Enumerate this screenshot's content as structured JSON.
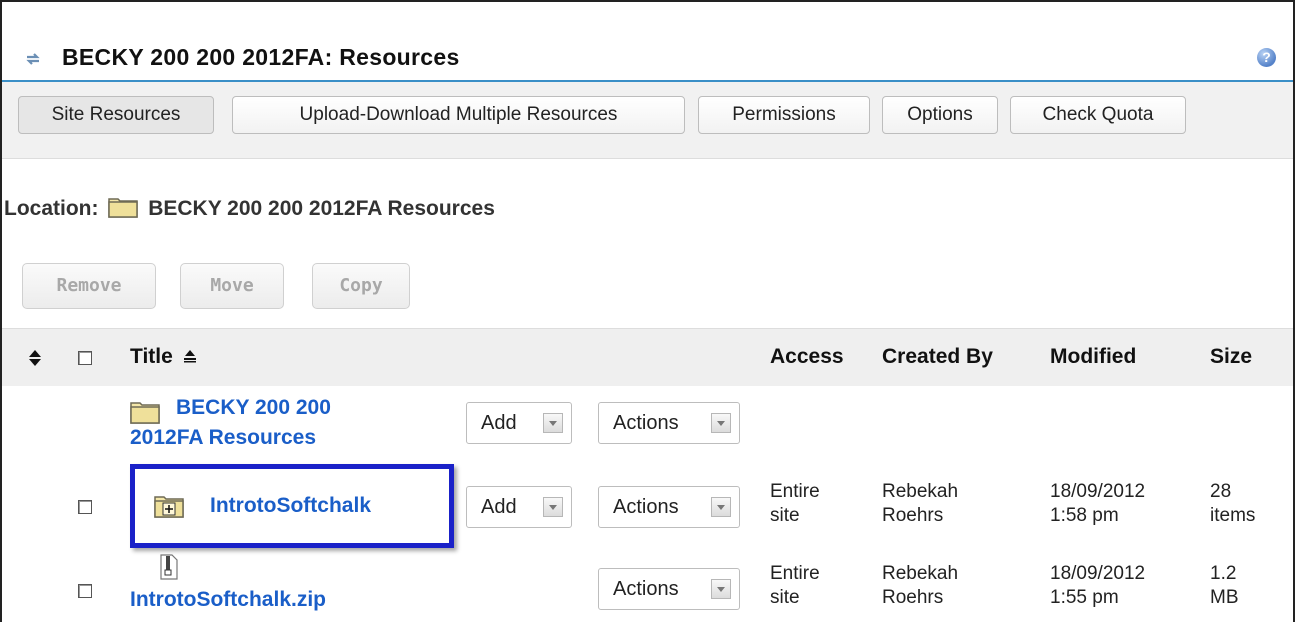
{
  "header": {
    "title": "BECKY 200 200 2012FA: Resources",
    "help_icon": "help-icon",
    "refresh_icon": "refresh-icon"
  },
  "toolbar": {
    "tabs": [
      {
        "label": "Site Resources",
        "active": true
      },
      {
        "label": "Upload-Download Multiple Resources"
      },
      {
        "label": "Permissions"
      },
      {
        "label": "Options"
      },
      {
        "label": "Check Quota"
      }
    ]
  },
  "location": {
    "label": "Location:",
    "value": "BECKY 200 200 2012FA Resources"
  },
  "actions": {
    "remove": "Remove",
    "move": "Move",
    "copy": "Copy"
  },
  "table": {
    "columns": {
      "title": "Title",
      "access": "Access",
      "created_by": "Created By",
      "modified": "Modified",
      "size": "Size"
    },
    "root": {
      "title_line1": "BECKY 200 200",
      "title_line2": "2012FA Resources",
      "add": "Add",
      "actions": "Actions"
    },
    "rows": [
      {
        "title": "IntrotoSoftchalk",
        "add": "Add",
        "actions": "Actions",
        "access_line1": "Entire",
        "access_line2": "site",
        "created_line1": "Rebekah",
        "created_line2": "Roehrs",
        "modified_line1": "18/09/2012",
        "modified_line2": "1:58 pm",
        "size_line1": "28",
        "size_line2": "items"
      },
      {
        "title": "IntrotoSoftchalk.zip",
        "actions": "Actions",
        "access_line1": "Entire",
        "access_line2": "site",
        "created_line1": "Rebekah",
        "created_line2": "Roehrs",
        "modified_line1": "18/09/2012",
        "modified_line2": "1:55 pm",
        "size_line1": "1.2",
        "size_line2": "MB"
      }
    ]
  },
  "colors": {
    "link": "#1a5ec8",
    "highlight_border": "#1a21c8",
    "header_rule": "#3a8fc7"
  }
}
